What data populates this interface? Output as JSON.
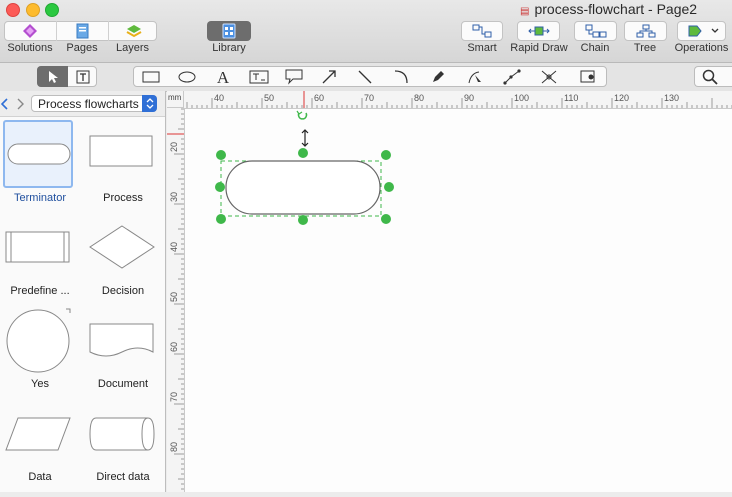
{
  "window": {
    "title": "process-flowchart - Page2"
  },
  "toolbar": {
    "left_group": [
      {
        "label": "Solutions",
        "icon": "solutions-icon"
      },
      {
        "label": "Pages",
        "icon": "pages-icon"
      },
      {
        "label": "Layers",
        "icon": "layers-icon"
      }
    ],
    "library_label": "Library",
    "right_items": [
      {
        "label": "Smart",
        "icon": "smart-connector-icon"
      },
      {
        "label": "Rapid Draw",
        "icon": "rapid-draw-icon"
      },
      {
        "label": "Chain",
        "icon": "chain-icon"
      },
      {
        "label": "Tree",
        "icon": "tree-icon"
      },
      {
        "label": "Operations",
        "icon": "operations-icon"
      }
    ]
  },
  "tools": [
    "pointer-tool-icon",
    "text-box-tool-icon",
    "rectangle-tool-icon",
    "ellipse-tool-icon",
    "text-tool-icon",
    "text-block-tool-icon",
    "callout-tool-icon",
    "arrow-tool-icon",
    "line-tool-icon",
    "arc-tool-icon",
    "pen-tool-icon",
    "bezier-tool-icon",
    "polyline-tool-icon",
    "connector-tool-icon",
    "insert-shape-tool-icon",
    "search-icon"
  ],
  "library": {
    "selected": "Process flowcharts",
    "shapes": [
      {
        "label": "Terminator",
        "selected": true
      },
      {
        "label": "Process"
      },
      {
        "label": "Predefine ..."
      },
      {
        "label": "Decision"
      },
      {
        "label": "Yes"
      },
      {
        "label": "Document"
      },
      {
        "label": "Data"
      },
      {
        "label": "Direct data"
      }
    ]
  },
  "ruler": {
    "unit": "mm",
    "top_labels": [
      "40",
      "50",
      "60",
      "70",
      "80",
      "90",
      "100",
      "110",
      "120",
      "130"
    ],
    "left_labels": [
      "20",
      "30",
      "40",
      "50",
      "60",
      "70",
      "80"
    ]
  },
  "colors": {
    "selection_handle": "#3fb84a",
    "accent_blue": "#2f6fd6",
    "shape_stroke": "#666666"
  }
}
